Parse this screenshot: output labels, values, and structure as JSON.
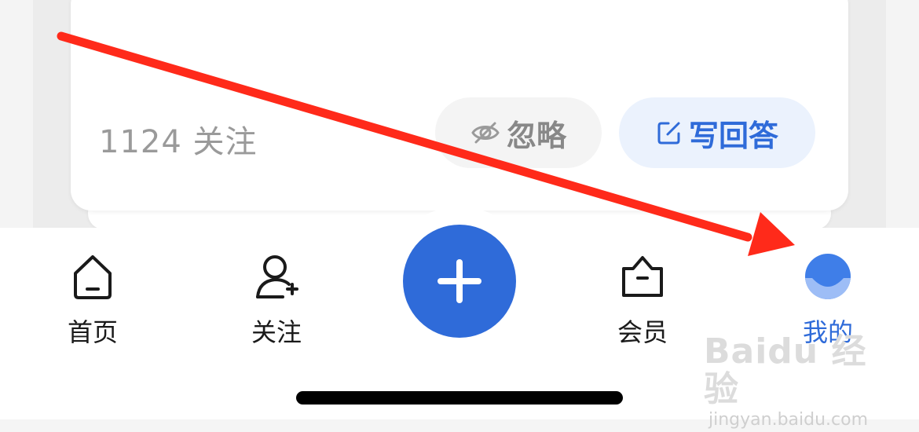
{
  "question_card": {
    "follow_count": "1124 关注",
    "ignore_label": "忽略",
    "answer_label": "写回答"
  },
  "tabbar": {
    "items": [
      {
        "id": "home",
        "label": "首页",
        "icon": "home-icon"
      },
      {
        "id": "follow",
        "label": "关注",
        "icon": "add-person-icon"
      },
      {
        "id": "create",
        "label": "",
        "icon": "plus-icon"
      },
      {
        "id": "vip",
        "label": "会员",
        "icon": "crown-bag-icon"
      },
      {
        "id": "me",
        "label": "我的",
        "icon": "avatar-icon"
      }
    ],
    "active": "me"
  },
  "watermark": {
    "logo_text": "Baidu 经验",
    "url": "jingyan.baidu.com"
  },
  "colors": {
    "accent": "#2f6bd9",
    "arrow": "#ff2a1a",
    "muted_text": "#9a9a9a"
  }
}
